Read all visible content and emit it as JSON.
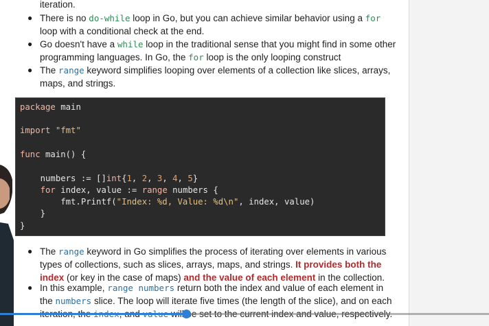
{
  "para1": {
    "line0": "iteration.",
    "b1_t1": "There is no ",
    "b1_c1": "do-while",
    "b1_t2": " loop in Go, but you can achieve similar behavior using a ",
    "b1_c2": "for",
    "b1_l2": "loop with a conditional check at the end.",
    "b2_t1": "Go doesn't have a ",
    "b2_c1": "while",
    "b2_t2": " loop in the traditional sense that you might find in some other",
    "b2_l2a": "programming languages. In Go, the ",
    "b2_c2": "for",
    "b2_l2b": " loop is the only looping construct",
    "b3_t1": "The ",
    "b3_c1": "range",
    "b3_t2": " keyword simplifies looping over elements of a collection like slices, arrays,",
    "b3_l2": "maps, and strings."
  },
  "code": {
    "l1_kw": "package",
    "l1_rest": " main",
    "l2_kw": "import",
    "l2_str": " \"fmt\"",
    "l3_kw": "func",
    "l3_rest": " main() {",
    "l4_a": "    numbers := []",
    "l4_kw": "int",
    "l4_b": "{",
    "l4_n1": "1",
    "l4_n2": "2",
    "l4_n3": "3",
    "l4_n4": "4",
    "l4_n5": "5",
    "l4_c": "}",
    "l5_a": "    ",
    "l5_kw1": "for",
    "l5_b": " index, value := ",
    "l5_kw2": "range",
    "l5_c": " numbers {",
    "l6_a": "        fmt.Printf(",
    "l6_str": "\"Index: %d, Value: %d\\n\"",
    "l6_b": ", index, value)",
    "l7": "    }",
    "l8": "}"
  },
  "para2": {
    "b1_t1": "The ",
    "b1_c1": "range",
    "b1_t2": " keyword in Go simplifies the process of iterating over elements in various",
    "b1_l2a": "types of collections, such as slices, arrays, maps, and strings. ",
    "b1_l2red": "It provides both the",
    "b1_l3red1": "index",
    "b1_l3t": " (or key in the case of maps) ",
    "b1_l3red2": "and the value of each element",
    "b1_l3end": " in the collection.",
    "b2_t1": "In this example, ",
    "b2_c1": "range numbers",
    "b2_t2": " return both the index and value of each element in",
    "b2_l2a": "the ",
    "b2_c2": "numbers",
    "b2_l2b": " slice. The loop will iterate five times (the length of the slice), and on each",
    "b2_l3a": "iteration, the ",
    "b2_c3": "index",
    "b2_l3b": ", and ",
    "b2_c4": "value",
    "b2_l3c": " will be set to the current index and value, respectively."
  },
  "player": {
    "progress": 0.38,
    "accent": "#2f7fd6"
  }
}
